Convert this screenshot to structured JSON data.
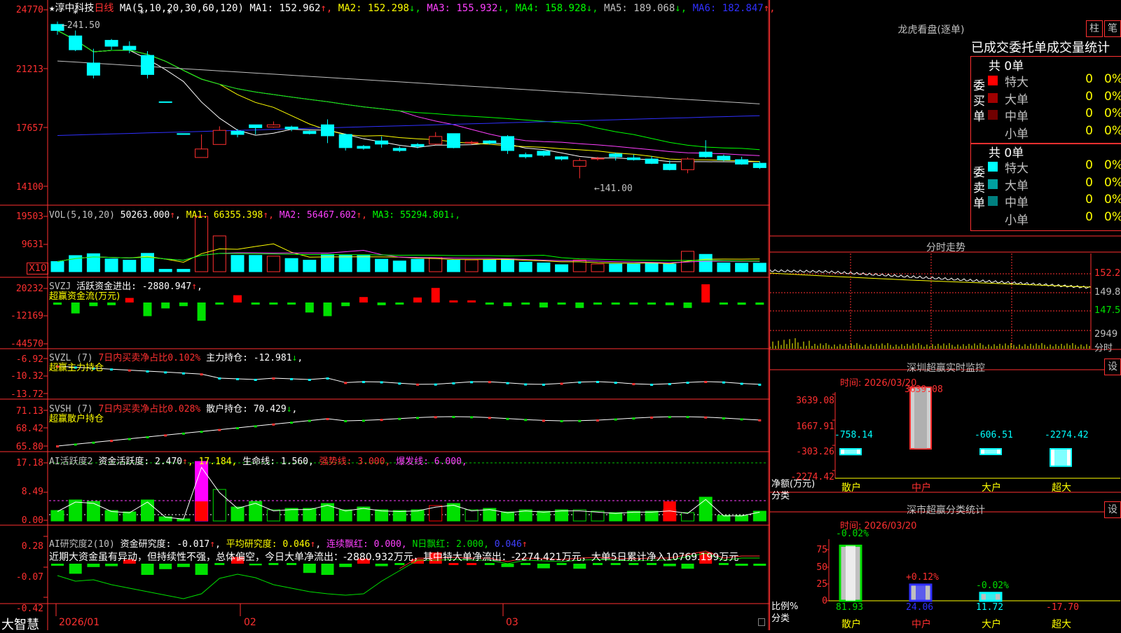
{
  "app": {
    "name": "大智慧"
  },
  "stock": {
    "star": "★",
    "name": "淳中科技",
    "period": "日线"
  },
  "ma_header": {
    "label": "MA(5,10,20,30,60,120)",
    "items": [
      {
        "t": "MA1: 152.962",
        "arrow": "↑",
        "color": "#ffffff"
      },
      {
        "t": "MA2: 152.298",
        "arrow": "↓",
        "color": "#ffff00"
      },
      {
        "t": "MA3: 155.932",
        "arrow": "↓",
        "color": "#ff40ff"
      },
      {
        "t": "MA4: 158.928",
        "arrow": "↓",
        "color": "#00ff00"
      },
      {
        "t": "MA5: 189.068",
        "arrow": "↓",
        "color": "#c0c0c0"
      },
      {
        "t": "MA6: 182.847",
        "arrow": "↑",
        "color": "#3030ff"
      }
    ]
  },
  "price_axis": [
    "24770",
    "21213",
    "17657",
    "14100"
  ],
  "annotations": {
    "high": "←241.50",
    "low": "←141.00"
  },
  "vol_panel": {
    "label": "VOL(5,10,20)",
    "value": "50263.000",
    "arrow": "↑",
    "items": [
      {
        "t": "MA1: 66355.398",
        "arrow": "↑",
        "color": "#ffff00"
      },
      {
        "t": "MA2: 56467.602",
        "arrow": "↑",
        "color": "#ff40ff"
      },
      {
        "t": "MA3: 55294.801",
        "arrow": "↓",
        "color": "#00ff00"
      }
    ],
    "axis": [
      "19503",
      "9631"
    ],
    "unit": "X10"
  },
  "svzj": {
    "label": "SVZJ",
    "title": "活跃资金进出: -2880.947",
    "arrow": "↑",
    "comma": ",",
    "sub": "超赢资金流(万元)",
    "axis": [
      "20232",
      "-12169",
      "-44570"
    ]
  },
  "svzl": {
    "label": "SVZL (7)",
    "red": "7日内买卖净占比0.102%",
    "white": "主力持仓: -12.981",
    "arrow": "↓",
    "comma": ",",
    "sub": "超赢主力持仓",
    "axis": [
      "-6.92",
      "-10.32",
      "-13.72"
    ]
  },
  "svsh": {
    "label": "SVSH (7)",
    "red": "7日内买卖净占比0.028%",
    "white": "散户持仓: 70.429",
    "arrow": "↓",
    "comma": ",",
    "sub": "超赢散户持仓",
    "axis": [
      "71.13",
      "68.42",
      "65.80"
    ]
  },
  "ai2": {
    "label": "AI活跃度2",
    "t1": "资金活跃度: 2.470",
    "a1": "↑",
    "t2": ", 17.184,",
    "t3": "生命线: 1.560,",
    "t4": "强势线: 3.000,",
    "t5": "爆发线: 6.000,",
    "axis": [
      "17.18",
      "8.49",
      "0.00"
    ]
  },
  "ai_res": {
    "label": "AI研究度2(10)",
    "t1": "资金研究度: -0.017",
    "a1": "↑",
    "t2": ",",
    "t3": "平均研究度: 0.046",
    "a3": "↑",
    "t4": ",",
    "t5": "连续飘红: 0.000,",
    "t6": "N日飘红: 2.000,",
    "t7": "0.046",
    "a7": "↑",
    "desc": "近期大资金虽有异动，但持续性不强，总体偏空，今日大单净流出：-2880.932万元，其中特大单净流出：-2274.421万元，大单5日累计净入10769.199万元",
    "axis": [
      "0.28",
      "-0.07",
      "-0.42"
    ]
  },
  "date_axis": [
    "2026/01",
    "02",
    "03"
  ],
  "dragon": {
    "title": "龙虎看盘(逐单)",
    "btn_bar": "柱",
    "btn_pen": "笔",
    "header": "已成交委托单成交量统计",
    "buy": {
      "side": "委买单",
      "total": "共 0单",
      "rows": [
        {
          "name": "特大",
          "v": "0",
          "p": "0%",
          "color": "#ff0000"
        },
        {
          "name": "大单",
          "v": "0",
          "p": "0%",
          "color": "#a00000"
        },
        {
          "name": "中单",
          "v": "0",
          "p": "0%",
          "color": "#700000"
        },
        {
          "name": "小单",
          "v": "0",
          "p": "0%",
          "color": "#000000"
        }
      ]
    },
    "sell": {
      "side": "委卖单",
      "total": "共 0单",
      "rows": [
        {
          "name": "特大",
          "v": "0",
          "p": "0%",
          "color": "#00ffff"
        },
        {
          "name": "大单",
          "v": "0",
          "p": "0%",
          "color": "#00a0a0"
        },
        {
          "name": "中单",
          "v": "0",
          "p": "0%",
          "color": "#008080"
        },
        {
          "name": "小单",
          "v": "0",
          "p": "0%",
          "color": "#000000"
        }
      ]
    }
  },
  "intraday": {
    "title": "分时走势",
    "axis": [
      "152.2",
      "149.8",
      "147.5",
      "2949",
      "分时"
    ]
  },
  "sz_monitor": {
    "title": "深圳超赢实时监控",
    "btn": "设",
    "time": "时间: 2026/03/20",
    "axis": [
      "3639.08",
      "1667.91",
      "-303.26",
      "-2274.42"
    ],
    "ylab1": "净额(万元)",
    "ylab2": "分类",
    "cats": [
      "散户",
      "中户",
      "大户",
      "超大"
    ],
    "values": [
      -758.14,
      3639.08,
      -606.51,
      -2274.42
    ],
    "value_labels": [
      "-758.14",
      "3639.08",
      "-606.51",
      "-2274.42"
    ]
  },
  "sz_class": {
    "title": "深市超赢分类统计",
    "btn": "设",
    "time": "时间: 2026/03/20",
    "axis": [
      "75",
      "50",
      "25",
      "0"
    ],
    "ylab1": "比例%",
    "ylab2": "分类",
    "cats": [
      "散户",
      "中户",
      "大户",
      "超大"
    ],
    "top_labels": [
      "-0.02%",
      "+0.12%",
      "-0.02%"
    ],
    "bottom_labels": [
      "81.93",
      "24.06",
      "11.72",
      "-17.70"
    ]
  },
  "chart_data": {
    "type": "candlestick",
    "candles_ohlc": [
      [
        236.6,
        238.3,
        230.5,
        233.0
      ],
      [
        229.8,
        233.0,
        220.8,
        221.6
      ],
      [
        213.8,
        222.2,
        204.7,
        206.6
      ],
      [
        227.2,
        228.0,
        221.6,
        223.7
      ],
      [
        223.7,
        226.6,
        219.6,
        221.6
      ],
      [
        218.3,
        220.8,
        204.7,
        207.0
      ],
      [
        190.9,
        190.9,
        190.5,
        190.5
      ],
      [
        172.1,
        172.1,
        171.6,
        171.6
      ],
      [
        158.0,
        171.6,
        158.0,
        163.0
      ],
      [
        165.7,
        176.4,
        165.7,
        174.0
      ],
      [
        173.5,
        174.8,
        169.9,
        171.6
      ],
      [
        177.3,
        177.3,
        171.6,
        175.6
      ],
      [
        176.0,
        179.3,
        175.6,
        177.3
      ],
      [
        176.0,
        176.8,
        173.5,
        174.8
      ],
      [
        173.5,
        173.9,
        171.6,
        172.1
      ],
      [
        177.3,
        180.5,
        166.5,
        170.8
      ],
      [
        171.6,
        172.1,
        162.1,
        163.8
      ],
      [
        164.6,
        165.4,
        162.6,
        163.4
      ],
      [
        167.8,
        170.4,
        163.8,
        165.9
      ],
      [
        163.4,
        164.6,
        161.2,
        162.1
      ],
      [
        165.7,
        166.5,
        163.4,
        164.6
      ],
      [
        165.9,
        173.0,
        165.4,
        170.4
      ],
      [
        172.1,
        172.1,
        163.4,
        163.8
      ],
      [
        166.5,
        167.8,
        165.7,
        167.0
      ],
      [
        167.8,
        168.2,
        165.7,
        166.5
      ],
      [
        170.4,
        171.2,
        160.1,
        162.1
      ],
      [
        159.7,
        160.9,
        157.4,
        158.4
      ],
      [
        161.7,
        162.1,
        158.4,
        159.3
      ],
      [
        158.4,
        158.8,
        156.2,
        157.1
      ],
      [
        152.8,
        157.5,
        145.7,
        156.2
      ],
      [
        157.1,
        158.4,
        156.2,
        157.5
      ],
      [
        160.1,
        160.9,
        156.2,
        158.4
      ],
      [
        157.8,
        159.7,
        156.2,
        156.7
      ],
      [
        157.1,
        158.8,
        154.1,
        154.5
      ],
      [
        154.1,
        156.2,
        150.4,
        150.8
      ],
      [
        150.8,
        158.0,
        148.7,
        157.1
      ],
      [
        161.2,
        168.2,
        157.8,
        158.4
      ],
      [
        158.8,
        159.7,
        155.8,
        156.6
      ],
      [
        156.7,
        158.4,
        153.7,
        154.1
      ],
      [
        154.6,
        155.8,
        151.2,
        152.0
      ]
    ],
    "volume": [
      11000,
      17500,
      19500,
      13800,
      12500,
      19900,
      2600,
      2600,
      60000,
      38800,
      17700,
      17700,
      16800,
      14300,
      12500,
      18800,
      17700,
      17500,
      13500,
      11600,
      13500,
      15300,
      12500,
      12800,
      12500,
      13800,
      10300,
      9500,
      7600,
      12600,
      8300,
      8300,
      8300,
      9800,
      8300,
      22100,
      18800,
      9500,
      9200,
      9200
    ],
    "svzj_values": [
      -2500,
      -12000,
      -4000,
      -3000,
      5000,
      -15000,
      -6500,
      -4000,
      -20000,
      -500,
      8000,
      -2000,
      -1500,
      -1500,
      -11000,
      -15000,
      -4000,
      6000,
      -3000,
      -1500,
      5500,
      16000,
      200,
      200,
      -1000,
      -4000,
      -1000,
      -5500,
      -1000,
      -6000,
      -1000,
      -500,
      -1000,
      -500,
      -3000,
      -6000,
      20000,
      -500,
      -2500,
      -2500
    ],
    "ma_values_current": {
      "MA1": 152.962,
      "MA2": 152.298,
      "MA3": 155.932,
      "MA4": 158.928,
      "MA5": 189.068,
      "MA6": 182.847
    },
    "y_range": [
      141.0,
      247.7
    ],
    "x_labels": [
      "2026/01",
      "02",
      "03"
    ]
  }
}
